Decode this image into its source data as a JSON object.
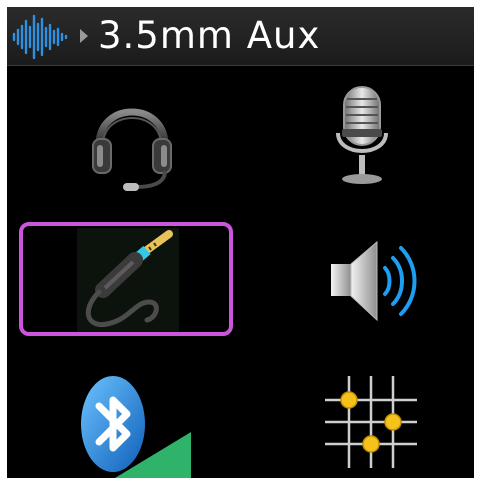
{
  "header": {
    "title": "3.5mm Aux"
  },
  "colors": {
    "accent_wave": "#2f8fe0",
    "selection_border": "#cc55dd",
    "jack_ring": "#33c7e8",
    "speaker_waves": "#1e9ef0",
    "bluetooth_blue": "#1a7fe0",
    "signal_green": "#2fb36b",
    "knob_yellow": "#f5c21b"
  },
  "menu": {
    "items": [
      {
        "icon": "headset-icon",
        "selected": false
      },
      {
        "icon": "microphone-icon",
        "selected": false
      },
      {
        "icon": "aux-cable-icon",
        "selected": true
      },
      {
        "icon": "speaker-icon",
        "selected": false
      },
      {
        "icon": "bluetooth-icon",
        "selected": false
      },
      {
        "icon": "equalizer-grid-icon",
        "selected": false
      }
    ]
  }
}
